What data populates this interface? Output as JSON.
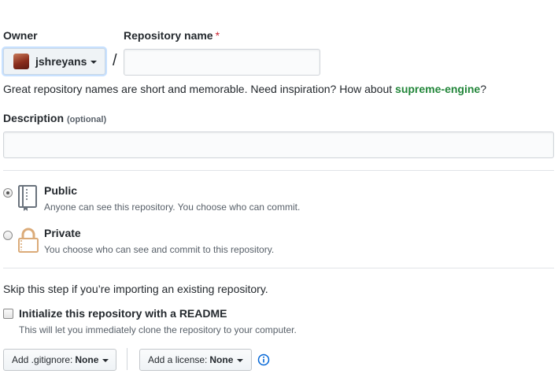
{
  "owner": {
    "label": "Owner",
    "name": "jshreyans"
  },
  "repository": {
    "label": "Repository name",
    "required_mark": "*",
    "separator": "/",
    "value": "",
    "hint_prefix": "Great repository names are short and memorable. Need inspiration? How about ",
    "suggestion": "supreme-engine",
    "hint_suffix": "?"
  },
  "description": {
    "label": "Description",
    "optional": "(optional)",
    "value": ""
  },
  "visibility": {
    "public": {
      "title": "Public",
      "description": "Anyone can see this repository. You choose who can commit.",
      "selected": true,
      "icon": "repo-icon"
    },
    "private": {
      "title": "Private",
      "description": "You choose who can see and commit to this repository.",
      "selected": false,
      "icon": "lock-icon"
    }
  },
  "init": {
    "skip_text": "Skip this step if you’re importing an existing repository.",
    "readme_label": "Initialize this repository with a README",
    "readme_desc": "This will let you immediately clone the repository to your computer.",
    "readme_checked": false
  },
  "gitignore": {
    "label": "Add .gitignore:",
    "value": "None"
  },
  "license": {
    "label": "Add a license:",
    "value": "None"
  },
  "colors": {
    "suggestion": "#22863a",
    "required": "#cb2431",
    "info": "#0366d6",
    "focus_ring": "#c8e1ff"
  }
}
